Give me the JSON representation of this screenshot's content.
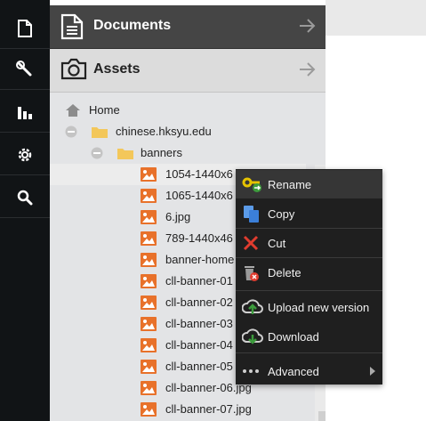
{
  "rail": {
    "items": [
      {
        "icon": "document-icon"
      },
      {
        "icon": "wrench-icon"
      },
      {
        "icon": "bar-chart-icon"
      },
      {
        "icon": "gear-icon"
      },
      {
        "icon": "search-icon"
      }
    ]
  },
  "panel": {
    "documents_label": "Documents",
    "assets_label": "Assets"
  },
  "tree": {
    "home": "Home",
    "site": "chinese.hksyu.edu",
    "folder": "banners",
    "files": [
      "1054-1440x6",
      "1065-1440x6",
      "6.jpg",
      "789-1440x46",
      "banner-home",
      "cll-banner-01",
      "cll-banner-02",
      "cll-banner-03",
      "cll-banner-04",
      "cll-banner-05",
      "cll-banner-06.jpg",
      "cll-banner-07.jpg"
    ]
  },
  "context_menu": {
    "rename": "Rename",
    "copy": "Copy",
    "cut": "Cut",
    "delete": "Delete",
    "upload": "Upload new version",
    "download": "Download",
    "advanced": "Advanced"
  },
  "colors": {
    "rail_bg": "#111416",
    "docs_header_bg": "#454545",
    "menu_bg": "#1f1f1f",
    "image_icon": "#e8712a",
    "folder_icon": "#f3c75a"
  }
}
